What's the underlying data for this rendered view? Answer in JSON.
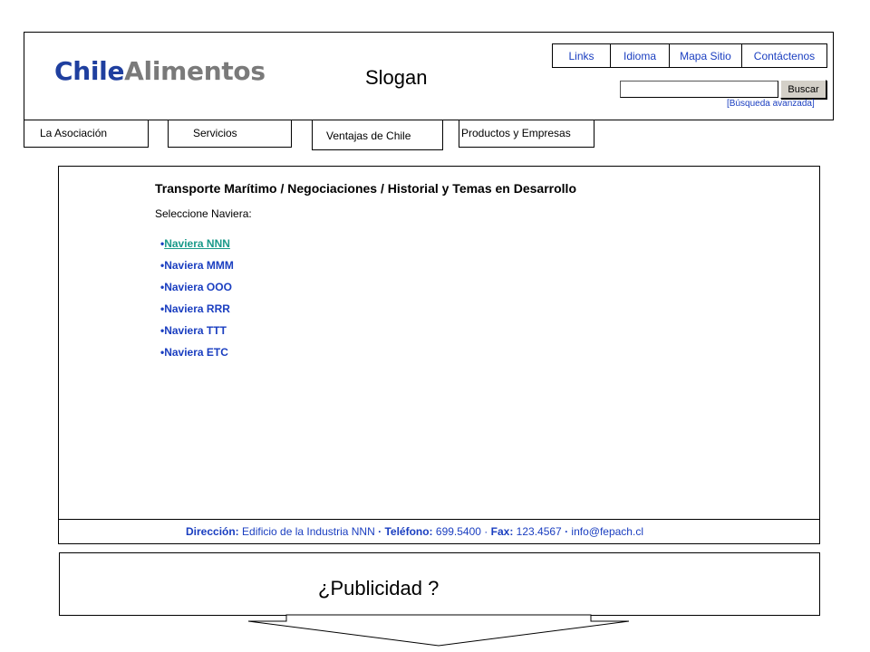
{
  "logo": {
    "part1": "Chile",
    "part2": "Alimentos"
  },
  "slogan": "Slogan",
  "top_nav": [
    "Links",
    "Idioma",
    "Mapa Sitio",
    "Contáctenos"
  ],
  "search": {
    "value": "",
    "button_label": "Buscar",
    "advanced_link": "[Búsqueda avanzada]"
  },
  "tabs": [
    "La Asociación",
    "Servicios",
    "Ventajas de Chile",
    "Productos y Empresas"
  ],
  "main": {
    "title": "Transporte Marítimo  / Negociaciones / Historial y Temas en Desarrollo",
    "select_label": "Seleccione Naviera:",
    "navieras": [
      "Naviera NNN",
      "Naviera MMM",
      "Naviera OOO",
      "Naviera RRR",
      "Naviera TTT",
      "Naviera ETC"
    ],
    "active_index": 0
  },
  "footer": {
    "direccion_label": "Dirección:",
    "direccion_value": "Edificio de la Industria NNN",
    "telefono_label": "Teléfono:",
    "telefono_value": "699.5400",
    "fax_label": "Fax:",
    "fax_value": "123.4567",
    "email": "info@fepach.cl"
  },
  "ad": {
    "text": "¿Publicidad ?"
  }
}
